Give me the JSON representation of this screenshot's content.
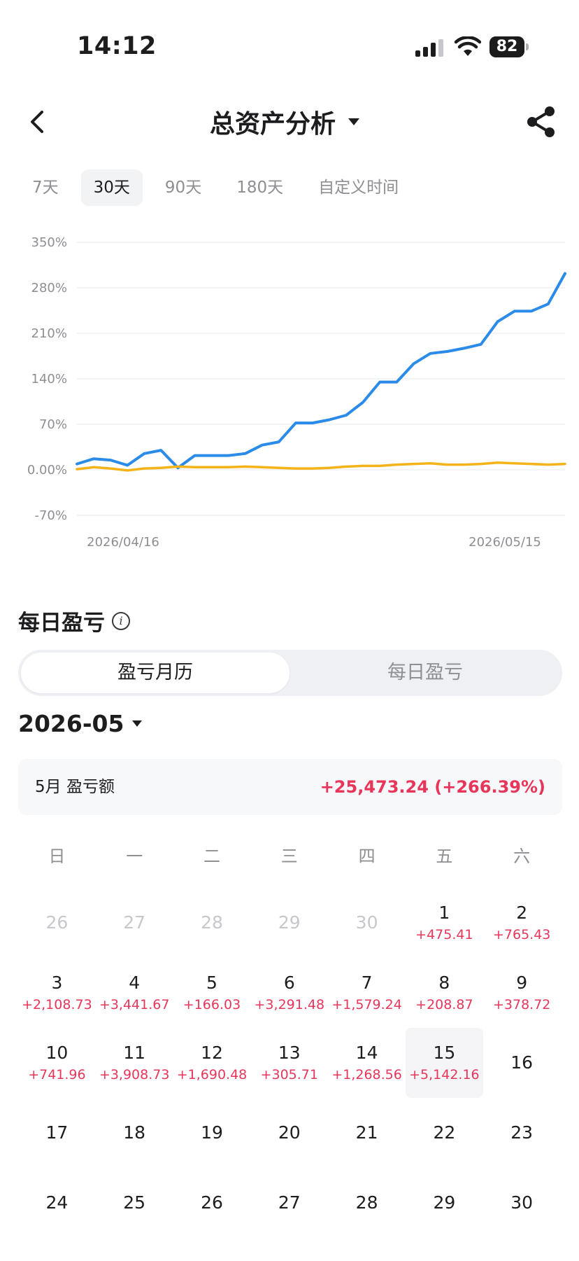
{
  "status": {
    "time": "14:12",
    "battery": "82"
  },
  "nav": {
    "title": "总资产分析"
  },
  "range_tabs": [
    {
      "label": "7天",
      "active": false
    },
    {
      "label": "30天",
      "active": true
    },
    {
      "label": "90天",
      "active": false
    },
    {
      "label": "180天",
      "active": false
    },
    {
      "label": "自定义时间",
      "active": false
    }
  ],
  "colors": {
    "accent_blue": "#2a8be8",
    "benchmark_yellow": "#f5b31a",
    "profit_red": "#e8365b",
    "muted_gray": "#8e8e93"
  },
  "chart_data": {
    "type": "line",
    "ylim": [
      -70,
      350
    ],
    "yticks": [
      350,
      280,
      210,
      140,
      70,
      0,
      -70
    ],
    "ytick_labels": [
      "350%",
      "280%",
      "210%",
      "140%",
      "70%",
      "0.00%",
      "-70%"
    ],
    "xtick_labels": [
      "2026/04/16",
      "2026/05/15"
    ],
    "grid": true,
    "series": [
      {
        "color": "#2a8be8",
        "values": [
          9,
          17,
          15,
          7,
          25,
          30,
          3,
          22,
          22,
          22,
          25,
          38,
          43,
          72,
          72,
          77,
          84,
          104,
          135,
          135,
          163,
          179,
          182,
          187,
          193,
          228,
          244,
          244,
          255,
          302
        ]
      },
      {
        "color": "#f5b31a",
        "values": [
          1,
          4,
          2,
          -1,
          2,
          3,
          5,
          4,
          4,
          4,
          5,
          4,
          3,
          2,
          2,
          3,
          5,
          6,
          6,
          8,
          9,
          10,
          8,
          8,
          9,
          11,
          10,
          9,
          8,
          9
        ]
      }
    ]
  },
  "daily_pnl": {
    "section_title": "每日盈亏",
    "segments": [
      "盈亏月历",
      "每日盈亏"
    ],
    "month": "2026-05",
    "summary_label": "5月 盈亏额",
    "summary_value": "+25,473.24 (+266.39%)",
    "weekdays": [
      "日",
      "一",
      "二",
      "三",
      "四",
      "五",
      "六"
    ],
    "days": [
      {
        "d": "26",
        "p": "",
        "muted": true
      },
      {
        "d": "27",
        "p": "",
        "muted": true
      },
      {
        "d": "28",
        "p": "",
        "muted": true
      },
      {
        "d": "29",
        "p": "",
        "muted": true
      },
      {
        "d": "30",
        "p": "",
        "muted": true
      },
      {
        "d": "1",
        "p": "+475.41"
      },
      {
        "d": "2",
        "p": "+765.43"
      },
      {
        "d": "3",
        "p": "+2,108.73"
      },
      {
        "d": "4",
        "p": "+3,441.67"
      },
      {
        "d": "5",
        "p": "+166.03"
      },
      {
        "d": "6",
        "p": "+3,291.48"
      },
      {
        "d": "7",
        "p": "+1,579.24"
      },
      {
        "d": "8",
        "p": "+208.87"
      },
      {
        "d": "9",
        "p": "+378.72"
      },
      {
        "d": "10",
        "p": "+741.96"
      },
      {
        "d": "11",
        "p": "+3,908.73"
      },
      {
        "d": "12",
        "p": "+1,690.48"
      },
      {
        "d": "13",
        "p": "+305.71"
      },
      {
        "d": "14",
        "p": "+1,268.56"
      },
      {
        "d": "15",
        "p": "+5,142.16",
        "today": true
      },
      {
        "d": "16",
        "p": ""
      },
      {
        "d": "17",
        "p": ""
      },
      {
        "d": "18",
        "p": ""
      },
      {
        "d": "19",
        "p": ""
      },
      {
        "d": "20",
        "p": ""
      },
      {
        "d": "21",
        "p": ""
      },
      {
        "d": "22",
        "p": ""
      },
      {
        "d": "23",
        "p": ""
      },
      {
        "d": "24",
        "p": ""
      },
      {
        "d": "25",
        "p": ""
      },
      {
        "d": "26",
        "p": ""
      },
      {
        "d": "27",
        "p": ""
      },
      {
        "d": "28",
        "p": ""
      },
      {
        "d": "29",
        "p": ""
      },
      {
        "d": "30",
        "p": ""
      }
    ]
  }
}
